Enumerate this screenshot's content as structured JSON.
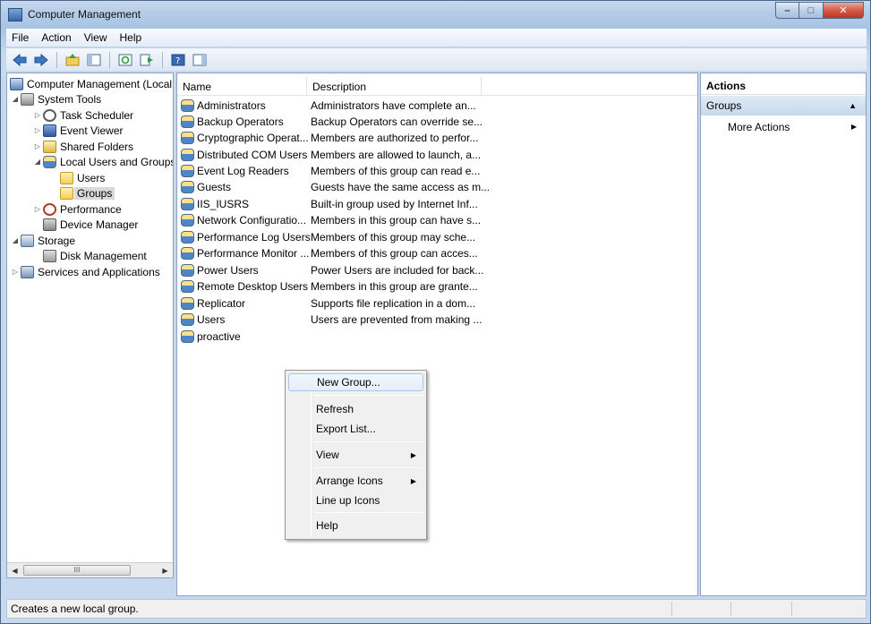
{
  "window": {
    "title": "Computer Management",
    "minimize_glyph": "–",
    "maximize_glyph": "□",
    "close_glyph": "✕"
  },
  "menubar": {
    "items": [
      "File",
      "Action",
      "View",
      "Help"
    ]
  },
  "toolbar": {
    "icons": [
      "back-arrow-icon",
      "forward-arrow-icon",
      "up-folder-icon",
      "show-hide-tree-icon",
      "refresh-icon",
      "export-list-icon",
      "help-icon",
      "show-hide-action-pane-icon"
    ]
  },
  "tree": {
    "items": [
      {
        "label": "Computer Management (Local"
      },
      {
        "label": "System Tools"
      },
      {
        "label": "Task Scheduler"
      },
      {
        "label": "Event Viewer"
      },
      {
        "label": "Shared Folders"
      },
      {
        "label": "Local Users and Groups"
      },
      {
        "label": "Users"
      },
      {
        "label": "Groups"
      },
      {
        "label": "Performance"
      },
      {
        "label": "Device Manager"
      },
      {
        "label": "Storage"
      },
      {
        "label": "Disk Management"
      },
      {
        "label": "Services and Applications"
      }
    ],
    "scroll_thumb_label": "III"
  },
  "list": {
    "columns": [
      "Name",
      "Description"
    ],
    "rows": [
      {
        "name": "Administrators",
        "description": "Administrators have complete an..."
      },
      {
        "name": "Backup Operators",
        "description": "Backup Operators can override se..."
      },
      {
        "name": "Cryptographic Operat...",
        "description": "Members are authorized to perfor..."
      },
      {
        "name": "Distributed COM Users",
        "description": "Members are allowed to launch, a..."
      },
      {
        "name": "Event Log Readers",
        "description": "Members of this group can read e..."
      },
      {
        "name": "Guests",
        "description": "Guests have the same access as m..."
      },
      {
        "name": "IIS_IUSRS",
        "description": "Built-in group used by Internet Inf..."
      },
      {
        "name": "Network Configuratio...",
        "description": "Members in this group can have s..."
      },
      {
        "name": "Performance Log Users",
        "description": "Members of this group may sche..."
      },
      {
        "name": "Performance Monitor ...",
        "description": "Members of this group can acces..."
      },
      {
        "name": "Power Users",
        "description": "Power Users are included for back..."
      },
      {
        "name": "Remote Desktop Users",
        "description": "Members in this group are grante..."
      },
      {
        "name": "Replicator",
        "description": "Supports file replication in a dom..."
      },
      {
        "name": "Users",
        "description": "Users are prevented from making ..."
      },
      {
        "name": "proactive",
        "description": ""
      }
    ]
  },
  "context_menu": {
    "new_group": "New Group...",
    "refresh": "Refresh",
    "export_list": "Export List...",
    "view": "View",
    "arrange_icons": "Arrange Icons",
    "line_up_icons": "Line up Icons",
    "help": "Help"
  },
  "actions": {
    "title": "Actions",
    "group": "Groups",
    "more_actions": "More Actions"
  },
  "status": {
    "text": "Creates a new local group."
  }
}
